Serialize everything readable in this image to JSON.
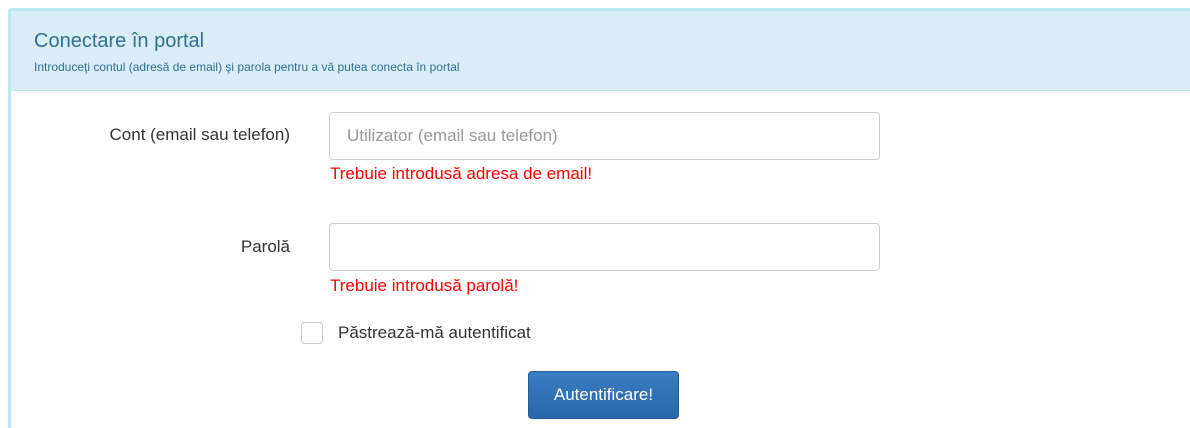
{
  "panel": {
    "title": "Conectare în portal",
    "subtitle": "Introduceţi contul (adresă de email) şi parola pentru a vă putea conecta în portal"
  },
  "form": {
    "account": {
      "label": "Cont (email sau telefon)",
      "placeholder": "Utilizator (email sau telefon)",
      "value": "",
      "error": "Trebuie introdusă adresa de email!"
    },
    "password": {
      "label": "Parolă",
      "placeholder": "",
      "value": "",
      "error": "Trebuie introdusă parolă!"
    },
    "remember": {
      "label": "Păstrează-mă autentificat",
      "checked": false
    },
    "submit_label": "Autentificare!"
  },
  "colors": {
    "heading_bg": "#d9edf7",
    "heading_text": "#31708f",
    "error": "#ff0000",
    "primary_button": "#2a65a8"
  }
}
